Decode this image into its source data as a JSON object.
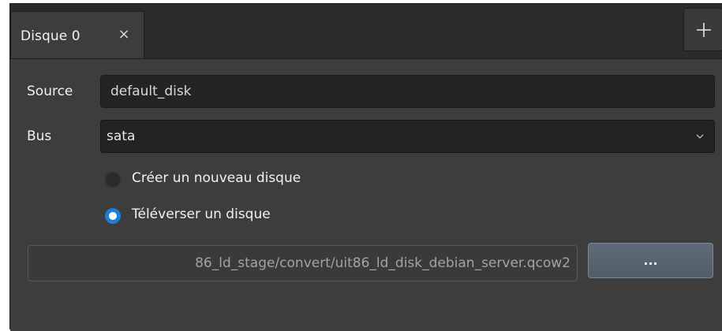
{
  "tabs": [
    {
      "label": "Disque 0",
      "close_glyph": "×",
      "close_icon": "close-icon"
    }
  ],
  "add_tab_icon": "plus-icon",
  "form": {
    "source": {
      "label": "Source",
      "value": "default_disk"
    },
    "bus": {
      "label": "Bus",
      "value": "sata",
      "icon": "chevron-down-icon"
    },
    "options": [
      {
        "label": "Créer un nouveau disque",
        "selected": false
      },
      {
        "label": "Téléverser un disque",
        "selected": true
      }
    ],
    "file_path": "86_ld_stage/convert/uit86_ld_disk_debian_server.qcow2",
    "browse_label": "..."
  },
  "colors": {
    "panel_bg": "#3d3d3d",
    "radio_accent": "#1c7fd6",
    "browse_button": "#5a6572"
  }
}
